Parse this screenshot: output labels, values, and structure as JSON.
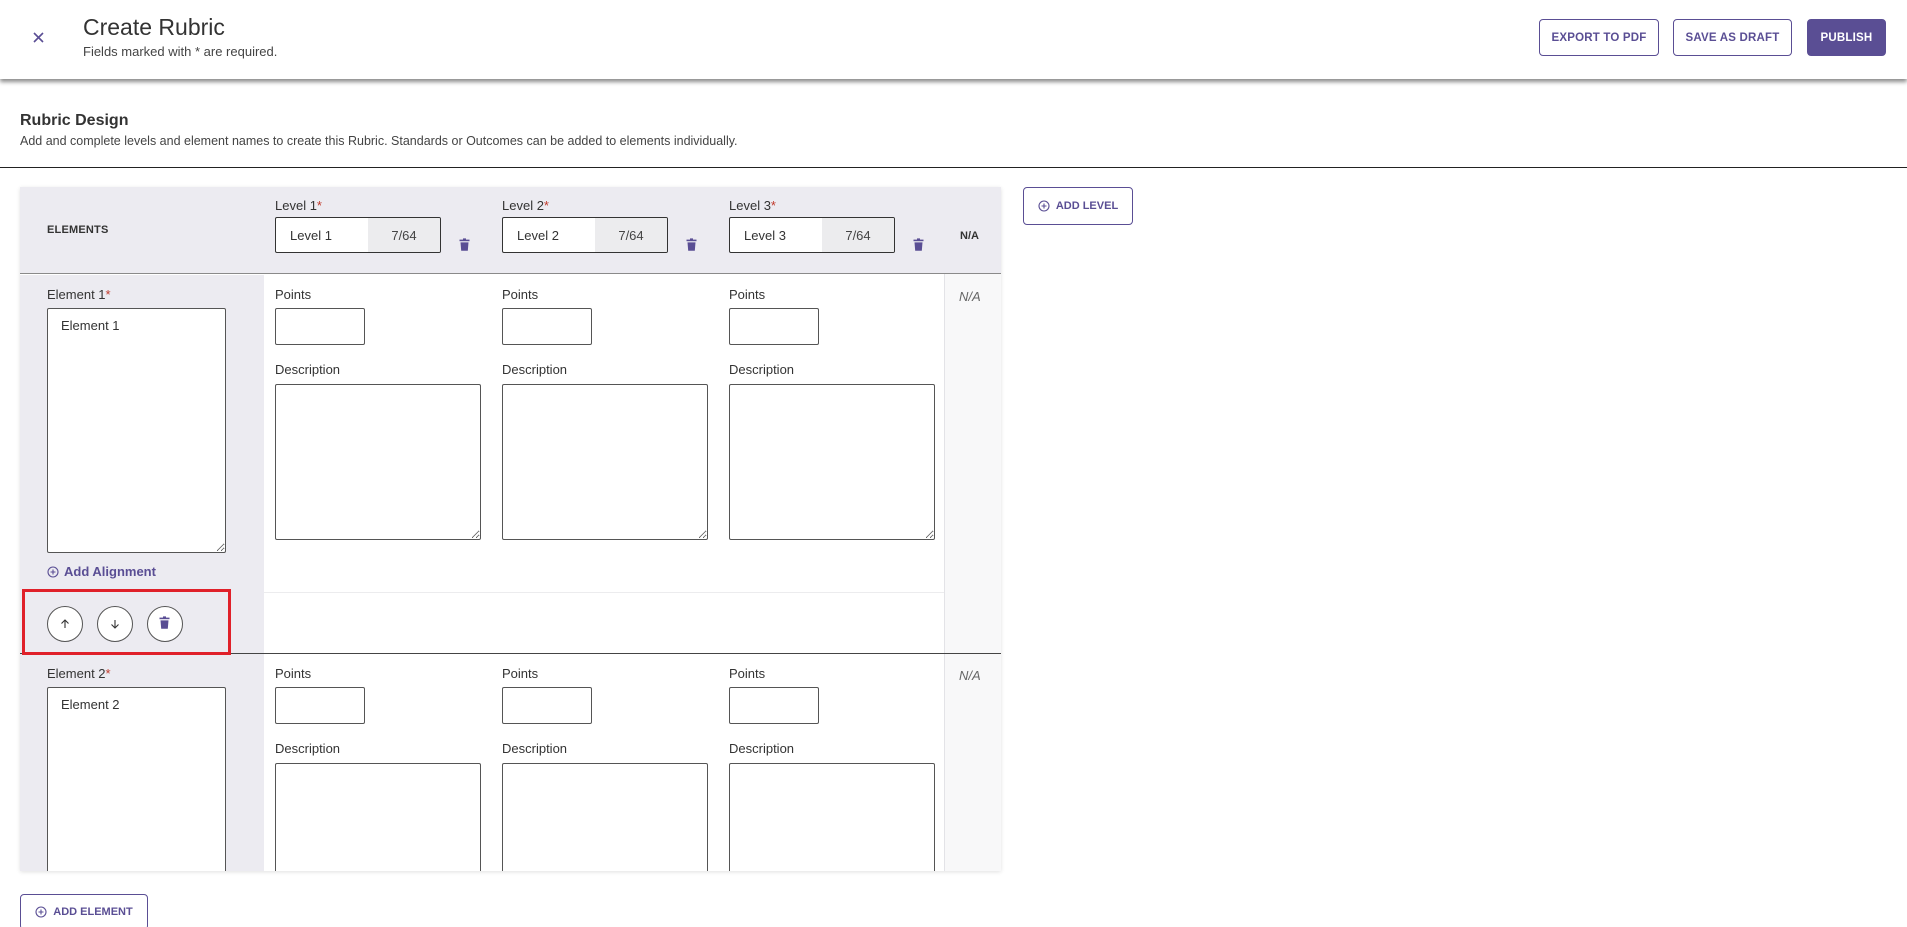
{
  "header": {
    "title": "Create Rubric",
    "subtitle": "Fields marked with * are required.",
    "export_label": "EXPORT TO PDF",
    "draft_label": "SAVE AS DRAFT",
    "publish_label": "PUBLISH",
    "accent": "#5a4e94"
  },
  "section": {
    "title": "Rubric Design",
    "description": "Add and complete levels and element names to create this Rubric. Standards or Outcomes can be added to elements individually."
  },
  "grid": {
    "elements_header": "ELEMENTS",
    "na_header": "N/A",
    "required_mark": "*",
    "levels": [
      {
        "label": "Level 1",
        "value": "Level 1",
        "count": "7/64"
      },
      {
        "label": "Level 2",
        "value": "Level 2",
        "count": "7/64"
      },
      {
        "label": "Level 3",
        "value": "Level 3",
        "count": "7/64"
      }
    ],
    "points_label": "Points",
    "description_label": "Description",
    "na_value": "N/A",
    "add_alignment_label": "Add Alignment",
    "elements": [
      {
        "label": "Element 1",
        "value": "Element 1"
      },
      {
        "label": "Element 2",
        "value": "Element 2"
      }
    ]
  },
  "actions": {
    "add_level_label": "ADD LEVEL",
    "add_element_label": "ADD ELEMENT"
  },
  "icons": {
    "close": "close-icon",
    "trash": "trash-icon",
    "arrow_up": "arrow-up-icon",
    "arrow_down": "arrow-down-icon",
    "plus_circle": "plus-circle-icon"
  },
  "highlight_color": "#e0202a"
}
